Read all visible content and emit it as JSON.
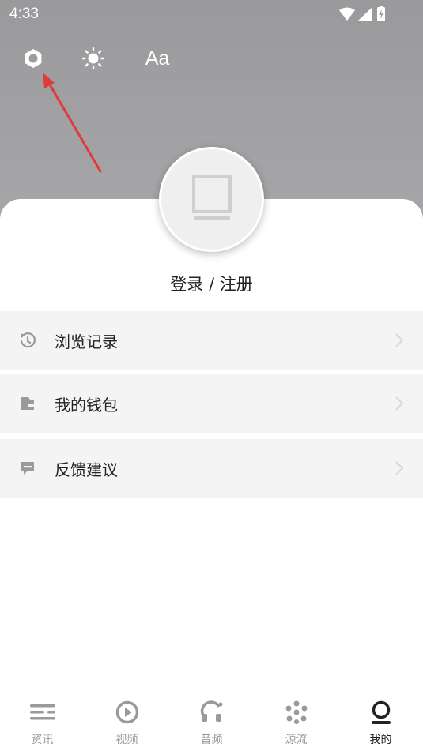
{
  "status_bar": {
    "time": "4:33"
  },
  "top_tools": {
    "font_label": "Aa"
  },
  "profile": {
    "login_label": "登录 / 注册"
  },
  "menu": [
    {
      "label": "浏览记录",
      "icon": "history-icon"
    },
    {
      "label": "我的钱包",
      "icon": "wallet-icon"
    },
    {
      "label": "反馈建议",
      "icon": "feedback-icon"
    }
  ],
  "bottom_nav": [
    {
      "label": "资讯",
      "icon": "news-icon"
    },
    {
      "label": "视频",
      "icon": "video-icon"
    },
    {
      "label": "音频",
      "icon": "audio-icon"
    },
    {
      "label": "源流",
      "icon": "sources-icon"
    },
    {
      "label": "我的",
      "icon": "profile-icon",
      "active": true
    }
  ],
  "colors": {
    "header": "#a0a0a2",
    "menu_bg": "#f4f4f4",
    "annotation_arrow": "#e0393e",
    "nav_inactive": "#9a9a9a",
    "nav_active": "#222222"
  }
}
